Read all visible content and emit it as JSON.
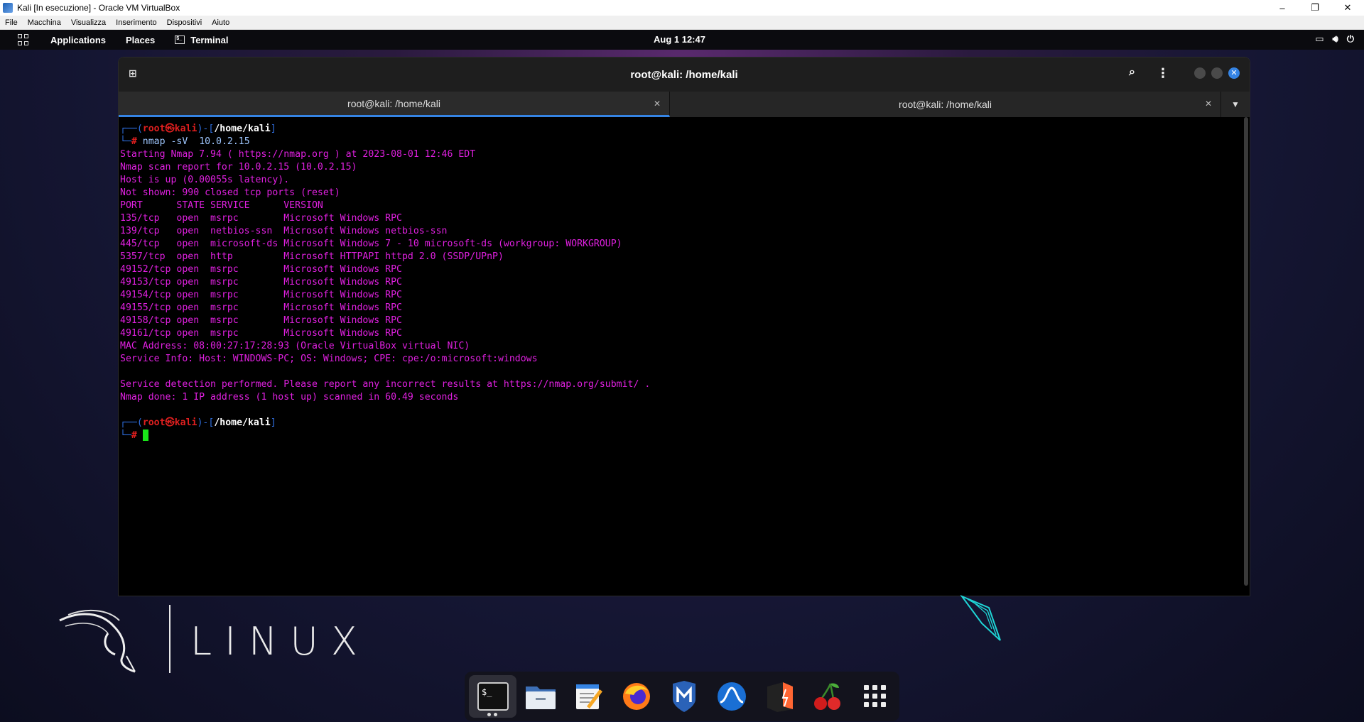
{
  "host": {
    "title": "Kali [In esecuzione] - Oracle VM VirtualBox",
    "menu": [
      "File",
      "Macchina",
      "Visualizza",
      "Inserimento",
      "Dispositivi",
      "Aiuto"
    ],
    "buttons": {
      "minimize": "–",
      "restore": "❐",
      "close": "✕"
    }
  },
  "topbar": {
    "applications": "Applications",
    "places": "Places",
    "terminal": "Terminal",
    "clock": "Aug 1  12:47"
  },
  "terminal": {
    "title": "root@kali: /home/kali",
    "tabs": [
      {
        "label": "root@kali: /home/kali",
        "active": true
      },
      {
        "label": "root@kali: /home/kali",
        "active": false
      }
    ],
    "prompt": {
      "user": "root",
      "at": "㉿",
      "host": "kali",
      "path": "/home/kali",
      "command": "nmap -sV  10.0.2.15"
    },
    "output": [
      "Starting Nmap 7.94 ( https://nmap.org ) at 2023-08-01 12:46 EDT",
      "Nmap scan report for 10.0.2.15 (10.0.2.15)",
      "Host is up (0.00055s latency).",
      "Not shown: 990 closed tcp ports (reset)",
      "PORT      STATE SERVICE      VERSION",
      "135/tcp   open  msrpc        Microsoft Windows RPC",
      "139/tcp   open  netbios-ssn  Microsoft Windows netbios-ssn",
      "445/tcp   open  microsoft-ds Microsoft Windows 7 - 10 microsoft-ds (workgroup: WORKGROUP)",
      "5357/tcp  open  http         Microsoft HTTPAPI httpd 2.0 (SSDP/UPnP)",
      "49152/tcp open  msrpc        Microsoft Windows RPC",
      "49153/tcp open  msrpc        Microsoft Windows RPC",
      "49154/tcp open  msrpc        Microsoft Windows RPC",
      "49155/tcp open  msrpc        Microsoft Windows RPC",
      "49158/tcp open  msrpc        Microsoft Windows RPC",
      "49161/tcp open  msrpc        Microsoft Windows RPC",
      "MAC Address: 08:00:27:17:28:93 (Oracle VirtualBox virtual NIC)",
      "Service Info: Host: WINDOWS-PC; OS: Windows; CPE: cpe:/o:microsoft:windows",
      "",
      "Service detection performed. Please report any incorrect results at https://nmap.org/submit/ .",
      "Nmap done: 1 IP address (1 host up) scanned in 60.49 seconds"
    ]
  },
  "desktop": {
    "brand": "LINUX"
  },
  "dock": [
    {
      "name": "terminal-emulator",
      "icon": "terminal-icon"
    },
    {
      "name": "file-manager",
      "icon": "folder-icon"
    },
    {
      "name": "text-editor",
      "icon": "text-editor-icon"
    },
    {
      "name": "firefox",
      "icon": "firefox-icon"
    },
    {
      "name": "metasploit",
      "icon": "metasploit-icon"
    },
    {
      "name": "wireshark",
      "icon": "wireshark-icon"
    },
    {
      "name": "burp-suite",
      "icon": "burp-icon"
    },
    {
      "name": "cherrytree",
      "icon": "cherry-icon"
    },
    {
      "name": "show-apps",
      "icon": "app-grid-icon"
    }
  ]
}
